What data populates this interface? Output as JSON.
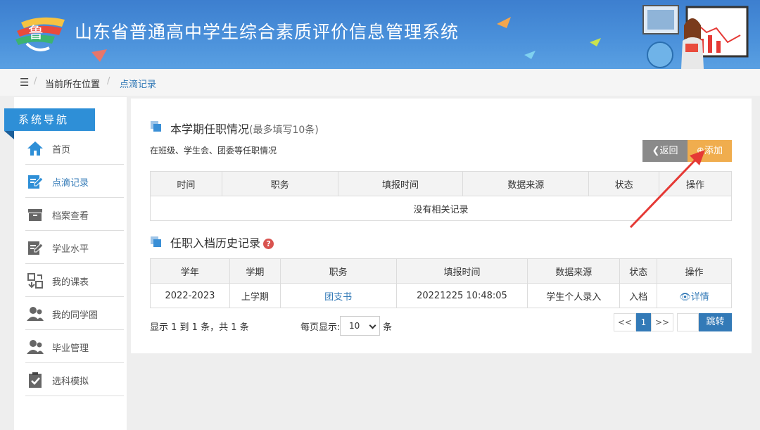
{
  "header": {
    "title": "山东省普通高中学生综合素质评价信息管理系统"
  },
  "breadcrumb": {
    "menu_icon": "hamburger-icon",
    "location_label": "当前所在位置",
    "separator": "/",
    "current": "点滴记录"
  },
  "sidebar": {
    "heading": "系统导航",
    "items": [
      {
        "label": "首页",
        "icon": "home-icon",
        "active": false
      },
      {
        "label": "点滴记录",
        "icon": "edit-icon",
        "active": true
      },
      {
        "label": "档案查看",
        "icon": "archive-icon",
        "active": false
      },
      {
        "label": "学业水平",
        "icon": "document-edit-icon",
        "active": false
      },
      {
        "label": "我的课表",
        "icon": "schedule-icon",
        "active": false
      },
      {
        "label": "我的同学圈",
        "icon": "users-icon",
        "active": false
      },
      {
        "label": "毕业管理",
        "icon": "user-group-icon",
        "active": false
      },
      {
        "label": "选科模拟",
        "icon": "clipboard-check-icon",
        "active": false
      }
    ]
  },
  "section1": {
    "title": "本学期任职情况",
    "subtitle": "(最多填写10条)",
    "description": "在班级、学生会、团委等任职情况",
    "back_label": "返回",
    "add_label": "添加",
    "columns": [
      "时间",
      "职务",
      "填报时间",
      "数据来源",
      "状态",
      "操作"
    ],
    "empty_text": "没有相关记录"
  },
  "section2": {
    "title": "任职入档历史记录",
    "help_mark": "?",
    "columns": [
      "学年",
      "学期",
      "职务",
      "填报时间",
      "数据来源",
      "状态",
      "操作"
    ],
    "rows": [
      {
        "year": "2022-2023",
        "term": "上学期",
        "position": "团支书",
        "time": "20221225 10:48:05",
        "source": "学生个人录入",
        "status": "入档",
        "action": "详情"
      }
    ]
  },
  "pagination": {
    "info": "显示 1 到 1 条，共 1 条",
    "per_page_label": "每页显示:",
    "per_page_value": "10",
    "unit": "条",
    "prev": "<<",
    "current_page": "1",
    "next": ">>",
    "go_label": "跳转"
  },
  "colors": {
    "header_blue": "#4a90da",
    "nav_blue": "#2e8fd7",
    "add_orange": "#f0ad4e",
    "back_gray": "#8a8a8a",
    "link_blue": "#337ab7",
    "annotation_red": "#e53935"
  }
}
